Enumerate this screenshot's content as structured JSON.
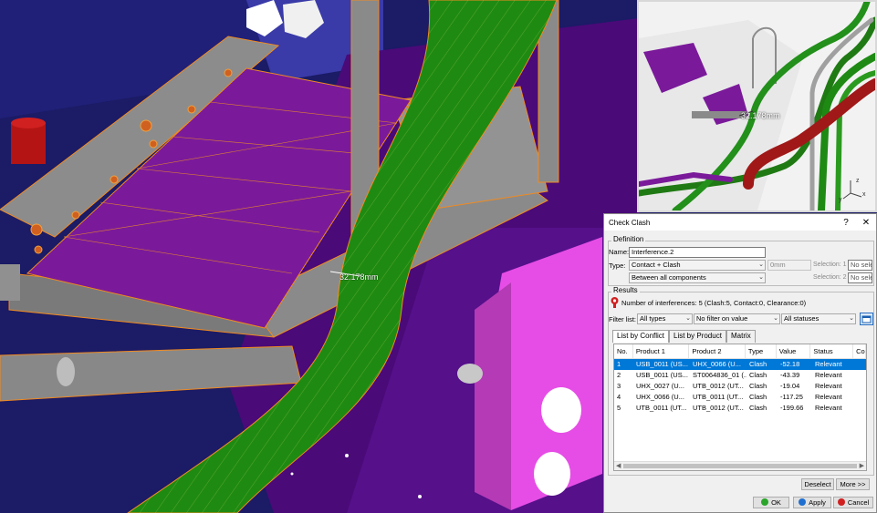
{
  "viewport": {
    "dimension_label": "32.178mm",
    "preview_dimension_label": "32.178mm",
    "axis_labels": [
      "y",
      "x",
      "z"
    ],
    "colors": {
      "background": "#1b1b66",
      "plate": "#7a1a9a",
      "frame": "#8a8a8a",
      "pipe": "#1f8a12",
      "wireframe": "#f08a20",
      "pink_part": "#e64de6"
    }
  },
  "dialog": {
    "title": "Check Clash",
    "help_icon": "?",
    "close_icon": "✕",
    "definition": {
      "group_label": "Definition",
      "name_label": "Name:",
      "name_value": "Interference.2",
      "type_label": "Type:",
      "type_value": "Contact + Clash",
      "clearance_value": "0mm",
      "scope_value": "Between all components",
      "selection1_label": "Selection: 1",
      "selection1_value": "No sele",
      "selection2_label": "Selection: 2",
      "selection2_value": "No sele"
    },
    "results": {
      "group_label": "Results",
      "summary": "Number of interferences: 5 (Clash:5, Contact:0, Clearance:0)",
      "filter_label": "Filter list:",
      "filter_types": "All types",
      "filter_value": "No filter on value",
      "filter_status": "All statuses",
      "tabs": [
        "List by Conflict",
        "List by Product",
        "Matrix"
      ],
      "active_tab": 0,
      "columns": [
        "No.",
        "Product 1",
        "Product 2",
        "Type",
        "Value",
        "Status",
        "Co"
      ],
      "rows": [
        [
          "1",
          "USB_0011 (US...",
          "UHX_0066 (U...",
          "Clash",
          "-52.18",
          "Relevant"
        ],
        [
          "2",
          "USB_0011 (US...",
          "ST0064836_01 (...",
          "Clash",
          "-43.39",
          "Relevant"
        ],
        [
          "3",
          "UHX_0027 (U...",
          "UTB_0012 (UT...",
          "Clash",
          "-19.04",
          "Relevant"
        ],
        [
          "4",
          "UHX_0066 (U...",
          "UTB_0011 (UT...",
          "Clash",
          "-117.25",
          "Relevant"
        ],
        [
          "5",
          "UTB_0011 (UT...",
          "UTB_0012 (UT...",
          "Clash",
          "-199.66",
          "Relevant"
        ]
      ],
      "selected_row": 0
    },
    "buttons": {
      "deselect": "Deselect",
      "more": "More >>",
      "ok": "OK",
      "apply": "Apply",
      "cancel": "Cancel"
    }
  }
}
